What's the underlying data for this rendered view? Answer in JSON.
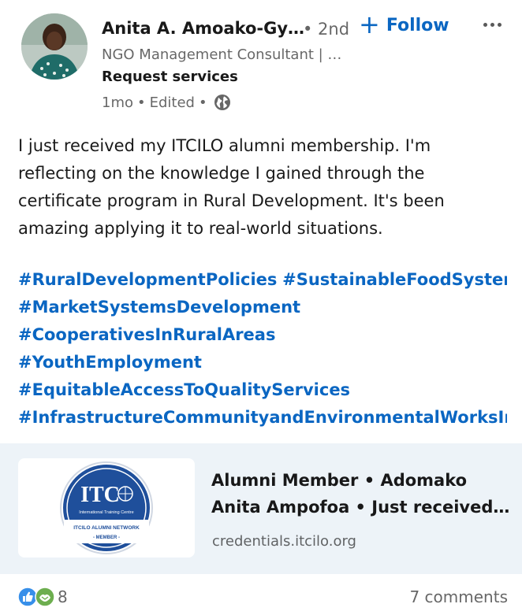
{
  "author": {
    "name": "Anita A. Amoako-Gy…",
    "degree": "• 2nd",
    "headline": "NGO Management Consultant | …",
    "request_services": "Request services",
    "time": "1mo",
    "sep1": "•",
    "edited": "Edited",
    "sep2": "•"
  },
  "actions": {
    "follow_plus": "+",
    "follow_label": "Follow"
  },
  "post": {
    "text": "I just received my ITCILO alumni membership. I'm reflecting on the knowledge I gained through the certificate program in Rural Development. It's been amazing applying it to real-world situations.",
    "hashtags": [
      "#RuralDevelopmentPolicies",
      "#SustainableFoodSystems",
      "#MarketSystemsDevelopment",
      "#CooperativesInRuralAreas",
      "#YouthEmployment",
      "#EquitableAccessToQualityServices",
      "#InfrastructureCommunityandEnvironmentalWorksInRu"
    ]
  },
  "preview": {
    "title": "Alumni Member • Adomako Anita Ampofoa • Just received…",
    "domain": "credentials.itcilo.org",
    "logo_text": "ITC",
    "logo_subtitle": "International Training Centre",
    "logo_network": "ITCILO ALUMNI NETWORK",
    "logo_member": "- MEMBER -"
  },
  "social": {
    "reaction_count": "8",
    "comments": "7 comments"
  },
  "colors": {
    "link_blue": "#0a66c2",
    "preview_bg": "#edf3f8",
    "badge_navy": "#1f4f9b"
  }
}
